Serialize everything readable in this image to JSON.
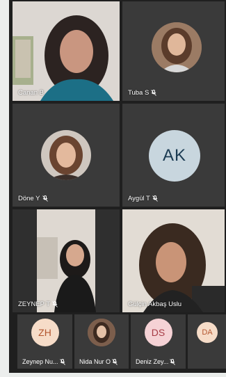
{
  "participants": {
    "canan": {
      "name": "Canan B"
    },
    "tuba": {
      "name": "Tuba S"
    },
    "done": {
      "name": "Döne Y"
    },
    "aygul": {
      "name": "Aygül T",
      "initials": "AK"
    },
    "zeynep": {
      "name": "ZEYNEP T"
    },
    "gulcin": {
      "name": "Gülçin Akbaş Uslu"
    }
  },
  "strip": [
    {
      "name": "Zeynep Nu...",
      "initials": "ZH"
    },
    {
      "name": "Nida Nur O"
    },
    {
      "name": "Deniz Zey...",
      "initials": "DS"
    },
    {
      "name": "",
      "initials": "DA"
    }
  ],
  "colors": {
    "tile_bg": "#3a3a3a",
    "grid_bg": "#1f1f1f",
    "avatar_ak_bg": "#c8d6de",
    "avatar_ak_text": "#1b3b52",
    "avatar_peach_bg": "#f6dcc8",
    "avatar_peach_text": "#b3562f",
    "avatar_pink_bg": "#f5d2d5",
    "avatar_pink_text": "#a63b45"
  }
}
